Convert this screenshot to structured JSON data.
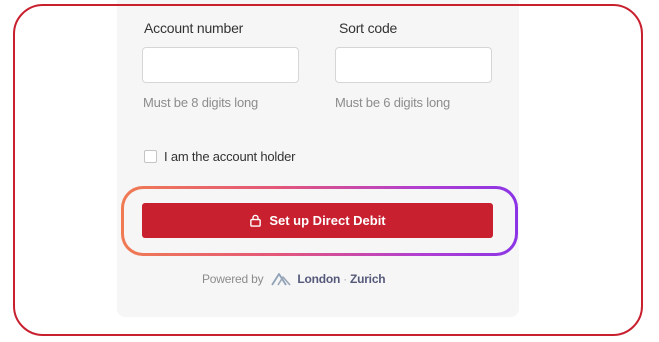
{
  "form": {
    "account_number": {
      "label": "Account number",
      "value": "",
      "hint": "Must be 8 digits long"
    },
    "sort_code": {
      "label": "Sort code",
      "value": "",
      "hint": "Must be 6 digits long"
    },
    "account_holder": {
      "label": "I am the account holder",
      "checked": false
    },
    "submit": {
      "label": "Set up Direct Debit",
      "icon": "lock-icon"
    }
  },
  "footer": {
    "powered_by": "Powered by",
    "brand_london": "London",
    "brand_zurich": "Zurich",
    "brand_icon": "london-zurich-logo-icon"
  },
  "colors": {
    "accent_red": "#c8202f",
    "frame_red": "#c8202f",
    "glow_start": "#f07b53",
    "glow_end": "#8b34e6",
    "card_bg": "#f6f6f6",
    "hint_text": "#8c8c8c"
  }
}
